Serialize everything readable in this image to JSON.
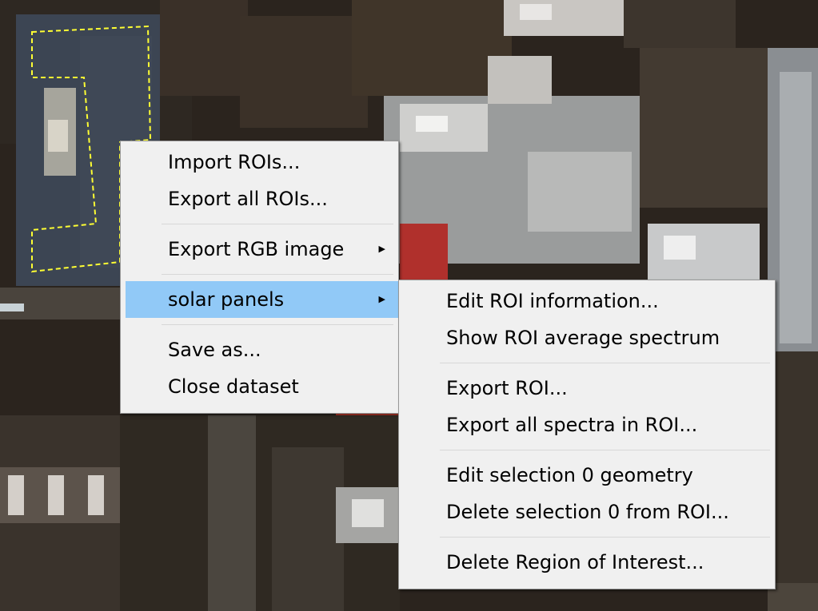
{
  "context_menu": {
    "items": [
      {
        "label": "Import ROIs..."
      },
      {
        "label": "Export all ROIs..."
      },
      {
        "label": "Export RGB image"
      },
      {
        "label": "solar panels"
      },
      {
        "label": "Save as..."
      },
      {
        "label": "Close dataset"
      }
    ]
  },
  "submenu": {
    "items": [
      {
        "label": "Edit ROI information..."
      },
      {
        "label": "Show ROI average spectrum"
      },
      {
        "label": "Export ROI..."
      },
      {
        "label": "Export all spectra in ROI..."
      },
      {
        "label": "Edit selection 0 geometry"
      },
      {
        "label": "Delete selection 0 from ROI..."
      },
      {
        "label": "Delete Region of Interest..."
      }
    ]
  },
  "colors": {
    "menu_background": "#f0f0f0",
    "highlight": "#91c9f7",
    "roi_outline": "#ffff33"
  },
  "icons": {
    "submenu_arrow": "triangle-right-icon"
  }
}
